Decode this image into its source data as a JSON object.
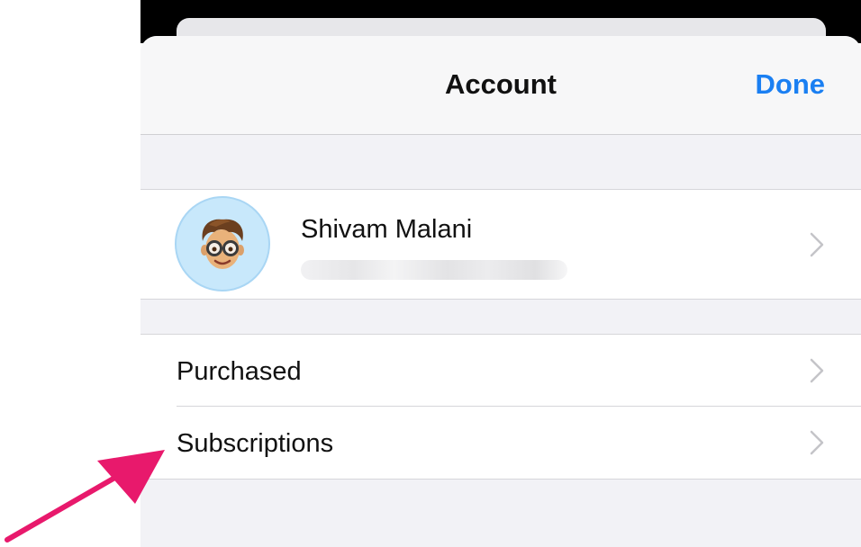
{
  "navbar": {
    "title": "Account",
    "done_label": "Done"
  },
  "profile": {
    "name": "Shivam Malani",
    "avatar_icon": "memoji-avatar-icon"
  },
  "menu": {
    "items": [
      {
        "label": "Purchased",
        "icon": "chevron-right-icon"
      },
      {
        "label": "Subscriptions",
        "icon": "chevron-right-icon"
      }
    ]
  },
  "colors": {
    "accent": "#1a7ff2",
    "annotation_arrow": "#e8196c",
    "avatar_background": "#c8e8fb"
  }
}
